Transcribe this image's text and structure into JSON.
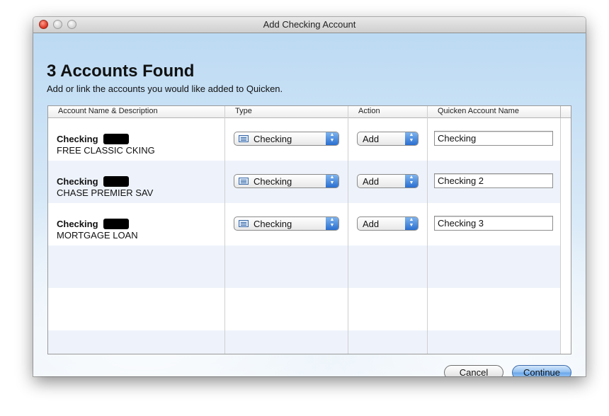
{
  "window": {
    "title": "Add Checking Account"
  },
  "dialog": {
    "heading": "3 Accounts Found",
    "subheading": "Add or link the accounts you would like added to Quicken."
  },
  "table": {
    "columns": [
      "Account Name & Description",
      "Type",
      "Action",
      "Quicken Account Name"
    ],
    "rows": [
      {
        "name": "Checking",
        "description": "FREE CLASSIC CKING",
        "type": "Checking",
        "action": "Add",
        "quicken_name": "Checking"
      },
      {
        "name": "Checking",
        "description": "CHASE PREMIER SAV",
        "type": "Checking",
        "action": "Add",
        "quicken_name": "Checking 2"
      },
      {
        "name": "Checking",
        "description": "MORTGAGE LOAN",
        "type": "Checking",
        "action": "Add",
        "quicken_name": "Checking 3"
      }
    ]
  },
  "buttons": {
    "cancel": "Cancel",
    "continue": "Continue"
  },
  "colors": {
    "titlebar": "#d8d8d8",
    "row_alt": "#eef3fb",
    "stepper": "#2a6fd0",
    "primary_button": "#8dbdf0"
  },
  "icons": {
    "window_close": "close-button-icon",
    "window_minimize": "minimize-button-icon",
    "window_zoom": "zoom-button-icon",
    "account_type": "ledger-icon",
    "popup_stepper": "up-down-arrows-icon"
  }
}
